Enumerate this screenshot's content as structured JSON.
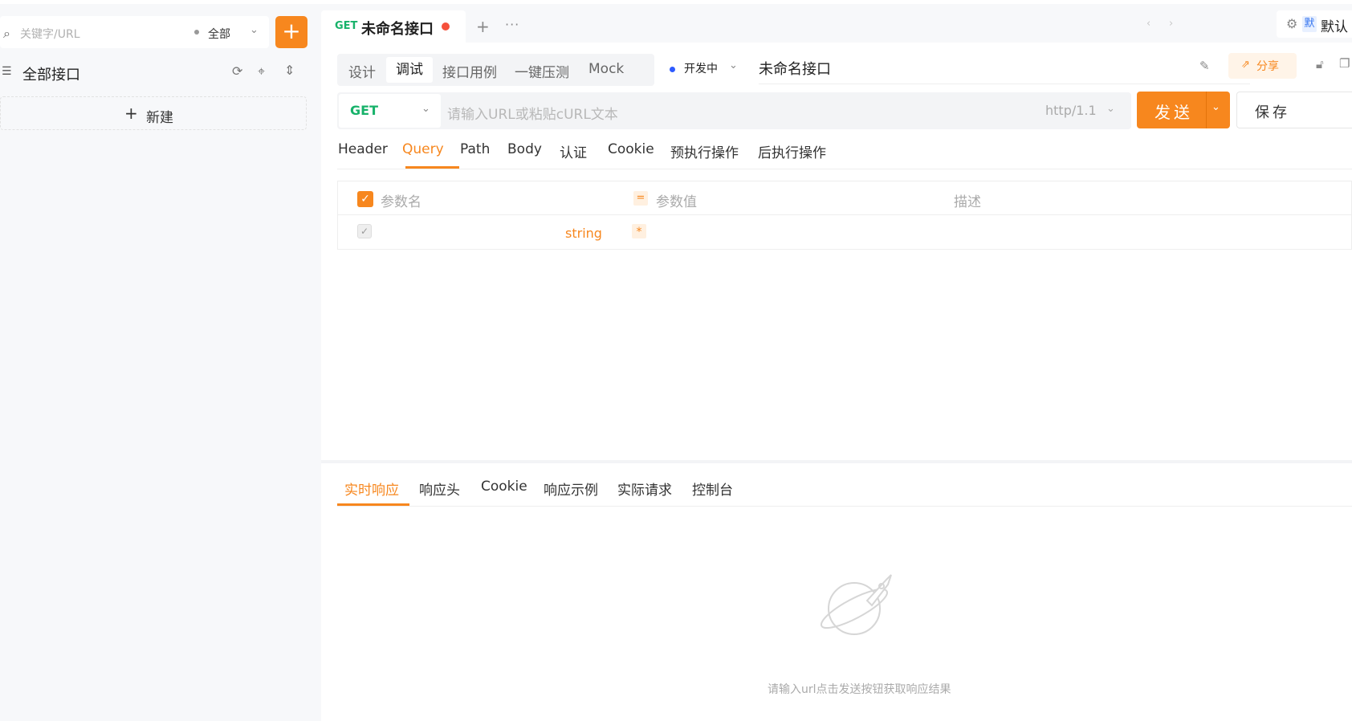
{
  "sidebar": {
    "search_placeholder": "关键字/URL",
    "scope": "全部",
    "add_label": "+",
    "all_label": "全部接口",
    "new_label": "新建"
  },
  "tabs": {
    "active": {
      "method": "GET",
      "title": "未命名接口"
    },
    "new_tab": "+",
    "more": "···",
    "env_badge": "默",
    "env_name": "默认"
  },
  "mode_tabs": [
    "设计",
    "调试",
    "接口用例",
    "一键压测",
    "Mock"
  ],
  "mode_active": "调试",
  "status": "开发中",
  "api_name": "未命名接口",
  "share_label": "分享",
  "request": {
    "method": "GET",
    "url_placeholder": "请输入URL或粘贴cURL文本",
    "protocol": "http/1.1",
    "send_label": "发送",
    "save_label": "保存"
  },
  "req_tabs": [
    "Header",
    "Query",
    "Path",
    "Body",
    "认证",
    "Cookie",
    "预执行操作",
    "后执行操作"
  ],
  "req_active": "Query",
  "params_table": {
    "col_name": "参数名",
    "eq": "=",
    "col_value": "参数值",
    "col_desc": "描述",
    "row_type": "string",
    "row_required": "*"
  },
  "resp_tabs": [
    "实时响应",
    "响应头",
    "Cookie",
    "响应示例",
    "实际请求",
    "控制台"
  ],
  "resp_active": "实时响应",
  "empty_text": "请输入url点击发送按钮获取响应结果",
  "colors": {
    "accent": "#f7871e",
    "get": "#17b26a",
    "status_dot": "#2e5bff",
    "dirty": "#f5503b"
  }
}
